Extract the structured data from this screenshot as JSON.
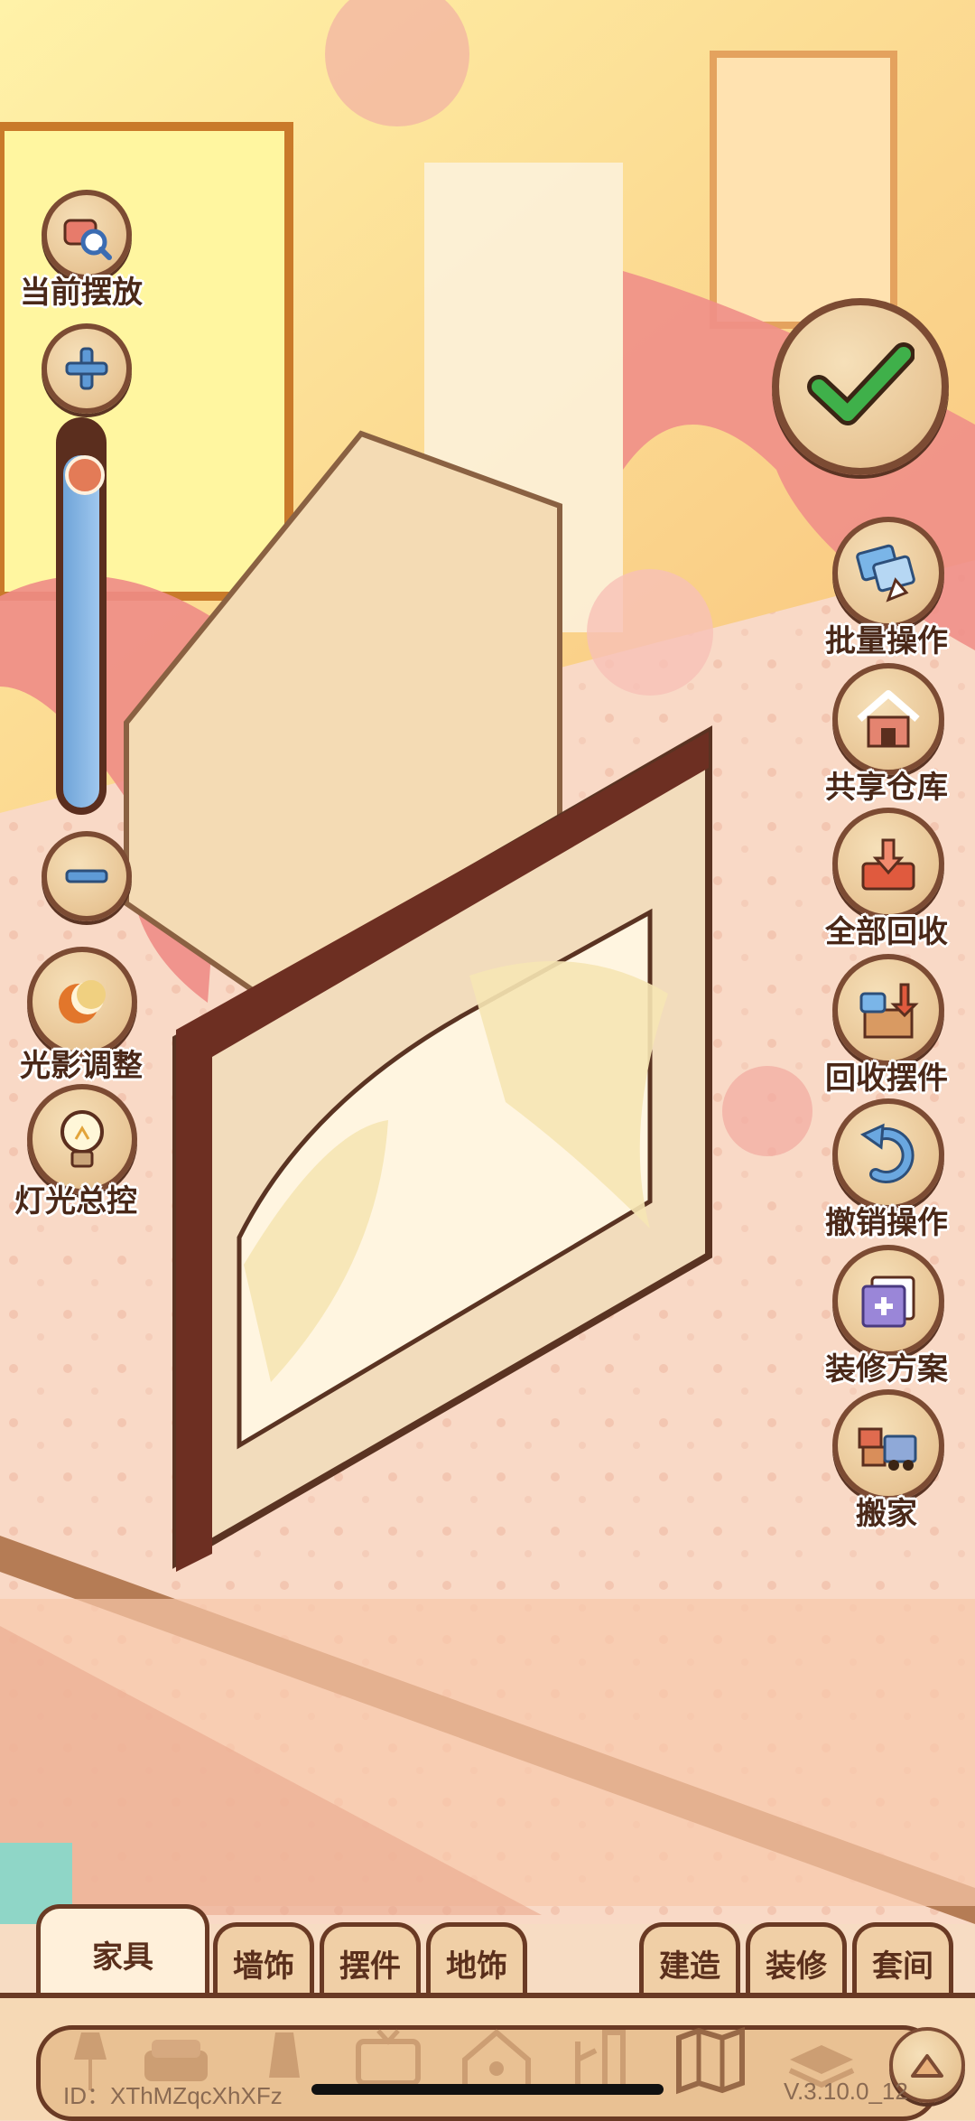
{
  "left_tools": {
    "current_placement": "当前摆放",
    "zoom_level": 0.92,
    "light_shadow": "光影调整",
    "light_master": "灯光总控"
  },
  "right_tools": {
    "batch": "批量操作",
    "shared_storage": "共享仓库",
    "recall_all": "全部回收",
    "recall_items": "回收摆件",
    "undo": "撤销操作",
    "renovation_plan": "装修方案",
    "move_house": "搬家"
  },
  "tabs": {
    "furniture": "家具",
    "wall": "墙饰",
    "ornament": "摆件",
    "floor": "地饰",
    "build": "建造",
    "renovate": "装修",
    "suite": "套间"
  },
  "footer": {
    "id": "ID：XThMZqcXhXFz",
    "version": "V.3.10.0_12"
  },
  "icons": [
    "magnifier-icon",
    "plus-icon",
    "minus-icon",
    "sun-moon-icon",
    "bulb-icon",
    "check-icon",
    "hand-cards-icon",
    "house-icon",
    "recall-tray-icon",
    "box-arrow-icon",
    "undo-arrow-icon",
    "plan-card-icon",
    "truck-icon",
    "lamp-icon",
    "sofa-icon",
    "tv-icon",
    "pet-house-icon",
    "plant-icon",
    "map-icon",
    "stack-icon",
    "up-arrow-icon"
  ]
}
